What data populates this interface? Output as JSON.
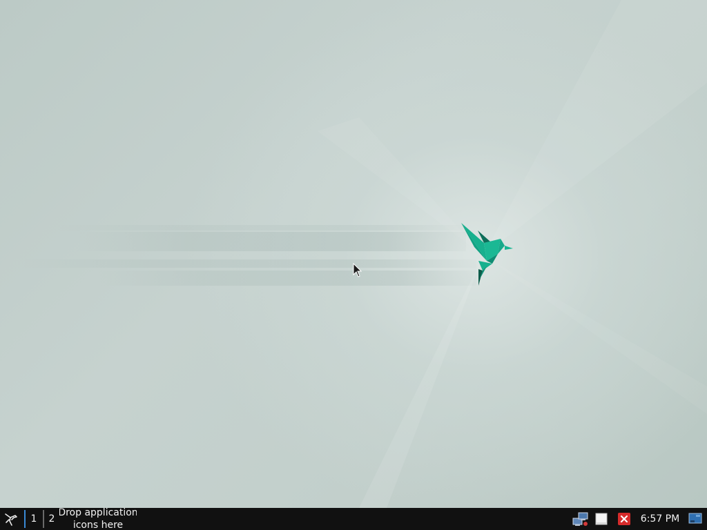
{
  "desktop": {
    "wallpaper": "origami-bird-wallpaper",
    "accent_color": "#1aa888"
  },
  "taskbar": {
    "menu_icon": "app-menu-icon",
    "workspaces": [
      {
        "label": "1",
        "active": true
      },
      {
        "label": "2",
        "active": false
      }
    ],
    "launcher_hint_line1": "Drop application",
    "launcher_hint_line2": "icons here",
    "tray": {
      "network_icon": "network-icon",
      "clipboard_icon": "clipboard-icon",
      "close_icon": "close-icon"
    },
    "clock": "6:57 PM",
    "show_desktop_icon": "show-desktop-icon",
    "active_workspace_color": "#3a8ad6"
  }
}
